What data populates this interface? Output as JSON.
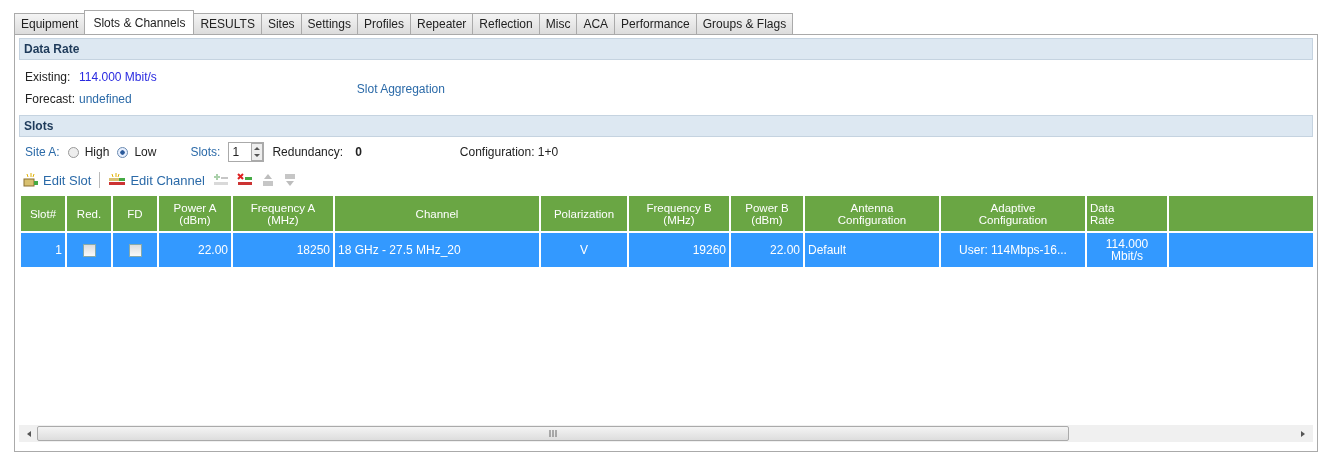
{
  "tabs": [
    {
      "label": "Equipment",
      "selected": false
    },
    {
      "label": "Slots & Channels",
      "selected": true
    },
    {
      "label": "RESULTS",
      "selected": false
    },
    {
      "label": "Sites",
      "selected": false
    },
    {
      "label": "Settings",
      "selected": false
    },
    {
      "label": "Profiles",
      "selected": false
    },
    {
      "label": "Repeater",
      "selected": false
    },
    {
      "label": "Reflection",
      "selected": false
    },
    {
      "label": "Misc",
      "selected": false
    },
    {
      "label": "ACA",
      "selected": false
    },
    {
      "label": "Performance",
      "selected": false
    },
    {
      "label": "Groups & Flags",
      "selected": false
    }
  ],
  "data_rate": {
    "title": "Data Rate",
    "existing_label": "Existing:",
    "existing_value": "114.000 Mbit/s",
    "forecast_label": "Forecast:",
    "forecast_value": "undefined",
    "aggregation_link": "Slot Aggregation"
  },
  "slots": {
    "title": "Slots",
    "site_label": "Site A:",
    "radios": [
      {
        "label": "High",
        "selected": false
      },
      {
        "label": "Low",
        "selected": true
      }
    ],
    "slots_label": "Slots:",
    "slots_value": "1",
    "redundancy_label": "Redundancy:",
    "redundancy_value": "0",
    "configuration": "Configuration: 1+0"
  },
  "toolbar": [
    {
      "kind": "edit-slot",
      "label": "Edit Slot",
      "disabled": false
    },
    {
      "kind": "edit-channel",
      "label": "Edit Channel",
      "disabled": false
    },
    {
      "kind": "add",
      "disabled": true
    },
    {
      "kind": "delete",
      "disabled": false
    },
    {
      "kind": "up",
      "disabled": true
    },
    {
      "kind": "down",
      "disabled": true
    }
  ],
  "table": {
    "columns": [
      "Slot#",
      "Red.",
      "FD",
      "Power A\n(dBm)",
      "Frequency A\n(MHz)",
      "Channel",
      "Polarization",
      "Frequency B\n(MHz)",
      "Power B\n(dBm)",
      "Antenna\nConfiguration",
      "Adaptive\nConfiguration",
      "Data\nRate"
    ],
    "rows": [
      {
        "selected": true,
        "cells": [
          {
            "kind": "text",
            "text": "1"
          },
          {
            "kind": "checkbox",
            "checked": false
          },
          {
            "kind": "checkbox",
            "checked": false
          },
          {
            "kind": "text",
            "text": "22.00"
          },
          {
            "kind": "text",
            "text": "18250"
          },
          {
            "kind": "text",
            "text": "18 GHz - 27.5 MHz_20"
          },
          {
            "kind": "text",
            "text": "V"
          },
          {
            "kind": "text",
            "text": "19260"
          },
          {
            "kind": "text",
            "text": "22.00"
          },
          {
            "kind": "text",
            "text": "Default"
          },
          {
            "kind": "text",
            "text": "User: 114Mbps-16..."
          },
          {
            "kind": "text",
            "text": "114.000\nMbit/s"
          }
        ]
      }
    ]
  }
}
